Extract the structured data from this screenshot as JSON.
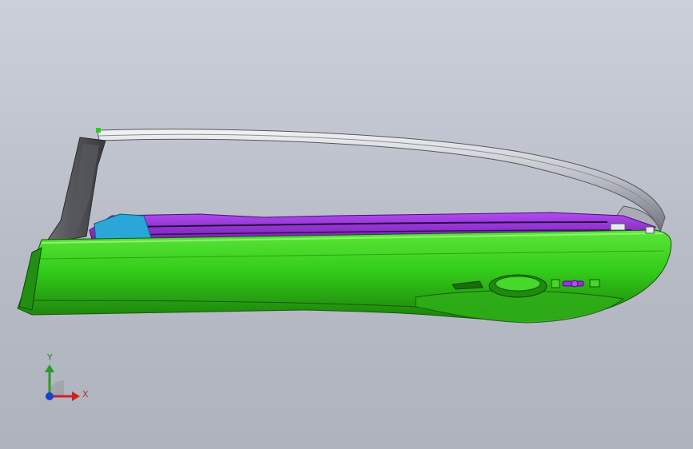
{
  "viewport": {
    "background_top": "#ccd0da",
    "background_bottom": "#aeb3bd"
  },
  "model": {
    "part": "car-door",
    "colors": {
      "body_green": "#33cc1a",
      "body_green_dark": "#1f8a0c",
      "trim_purple": "#9a2ee0",
      "trim_cyan": "#2aa6d8",
      "window_frame_gray": "#c8cad0",
      "pillar_dark": "#4a4c50"
    }
  },
  "triad": {
    "y_label": "Y",
    "x_label": "X",
    "y_color": "#2a9a2a",
    "x_color": "#d02020",
    "z_color": "#1a3fd0"
  }
}
